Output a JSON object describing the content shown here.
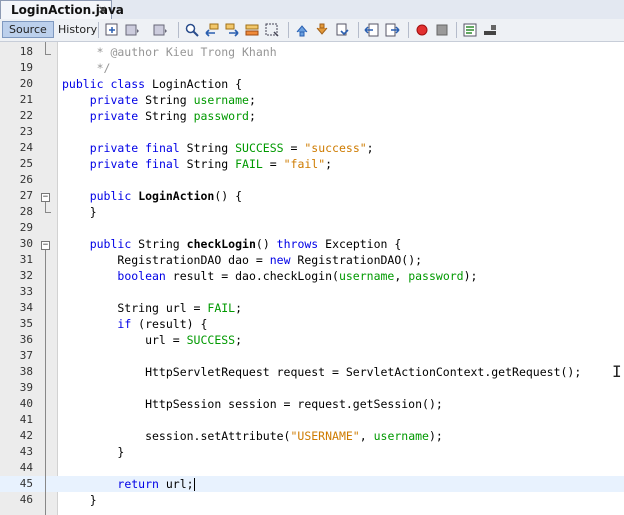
{
  "tab": {
    "file_name": "LoginAction.java",
    "close_glyph": "×"
  },
  "toolbar": {
    "source_label": "Source",
    "history_label": "History"
  },
  "editor": {
    "lines": [
      {
        "num": "18",
        "text": "     * @author Kieu Trong Khanh"
      },
      {
        "num": "19",
        "text": "     */"
      },
      {
        "num": "20",
        "text": "public class LoginAction {"
      },
      {
        "num": "21",
        "text": "    private String username;"
      },
      {
        "num": "22",
        "text": "    private String password;"
      },
      {
        "num": "23",
        "text": ""
      },
      {
        "num": "24",
        "text": "    private final String SUCCESS = \"success\";"
      },
      {
        "num": "25",
        "text": "    private final String FAIL = \"fail\";"
      },
      {
        "num": "26",
        "text": ""
      },
      {
        "num": "27",
        "text": "    public LoginAction() {"
      },
      {
        "num": "28",
        "text": "    }"
      },
      {
        "num": "29",
        "text": ""
      },
      {
        "num": "30",
        "text": "    public String checkLogin() throws Exception {"
      },
      {
        "num": "31",
        "text": "        RegistrationDAO dao = new RegistrationDAO();"
      },
      {
        "num": "32",
        "text": "        boolean result = dao.checkLogin(username, password);"
      },
      {
        "num": "33",
        "text": ""
      },
      {
        "num": "34",
        "text": "        String url = FAIL;"
      },
      {
        "num": "35",
        "text": "        if (result) {"
      },
      {
        "num": "36",
        "text": "            url = SUCCESS;"
      },
      {
        "num": "37",
        "text": ""
      },
      {
        "num": "38",
        "text": "            HttpServletRequest request = ServletActionContext.getRequest();"
      },
      {
        "num": "39",
        "text": ""
      },
      {
        "num": "40",
        "text": "            HttpSession session = request.getSession();"
      },
      {
        "num": "41",
        "text": ""
      },
      {
        "num": "42",
        "text": "            session.setAttribute(\"USERNAME\", username);"
      },
      {
        "num": "43",
        "text": "        }"
      },
      {
        "num": "44",
        "text": ""
      },
      {
        "num": "45",
        "text": "        return url;"
      },
      {
        "num": "46",
        "text": "    }"
      }
    ]
  },
  "colors": {
    "keyword": "#0000e6",
    "string": "#ce7b00",
    "field": "#009900",
    "comment": "#969696",
    "current_line": "#e8f2fe"
  }
}
